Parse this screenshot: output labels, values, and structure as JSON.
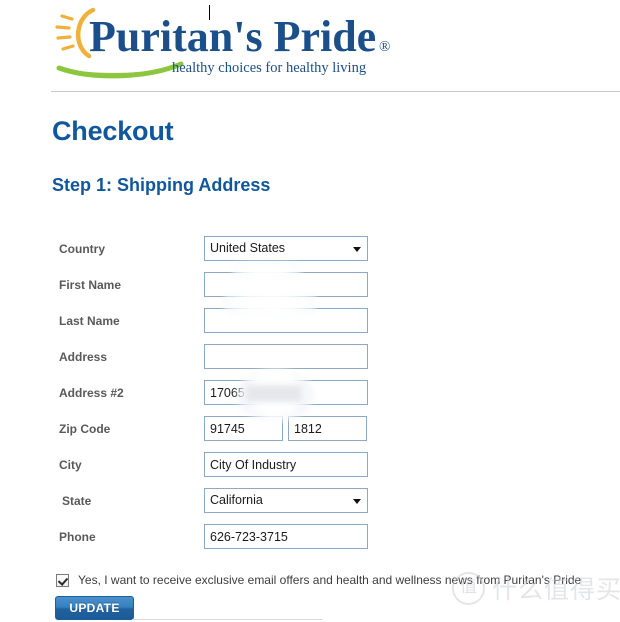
{
  "brand": {
    "name": "Puritan's Pride",
    "tagline": "healthy choices for healthy living",
    "colors": {
      "navy": "#1b4f8a",
      "sun": "#f0b13c",
      "swoosh": "#8cc63f",
      "heading": "#10579e",
      "button": "#2f7cbb"
    }
  },
  "headings": {
    "page_title": "Checkout",
    "step_title": "Step 1: Shipping Address"
  },
  "form": {
    "rows": [
      {
        "label": "Country",
        "type": "select",
        "value": "United States",
        "name": "country"
      },
      {
        "label": "First Name",
        "type": "text",
        "value": "",
        "name": "first-name",
        "redacted": true
      },
      {
        "label": "Last Name",
        "type": "text",
        "value": "",
        "name": "last-name",
        "redacted": true,
        "focused": true
      },
      {
        "label": "Address",
        "type": "text",
        "value": "",
        "name": "address"
      },
      {
        "label": "Address #2",
        "type": "text",
        "value": "17065",
        "name": "address-2",
        "redacted": true
      },
      {
        "label": "Zip Code",
        "type": "zip",
        "value": "91745",
        "value2": "1812",
        "name": "zip-code"
      },
      {
        "label": "City",
        "type": "text",
        "value": "City Of Industry",
        "name": "city"
      },
      {
        "label": "State",
        "type": "select",
        "value": "California",
        "name": "state"
      },
      {
        "label": "Phone",
        "type": "text",
        "value": "626-723-3715",
        "name": "phone"
      }
    ]
  },
  "optin": {
    "checked": true,
    "label": "Yes, I want to receive exclusive email offers and health and wellness news from Puritan's Pride"
  },
  "actions": {
    "update_label": "UPDATE"
  },
  "watermark": {
    "mark": "值",
    "text": "什么值得买"
  }
}
